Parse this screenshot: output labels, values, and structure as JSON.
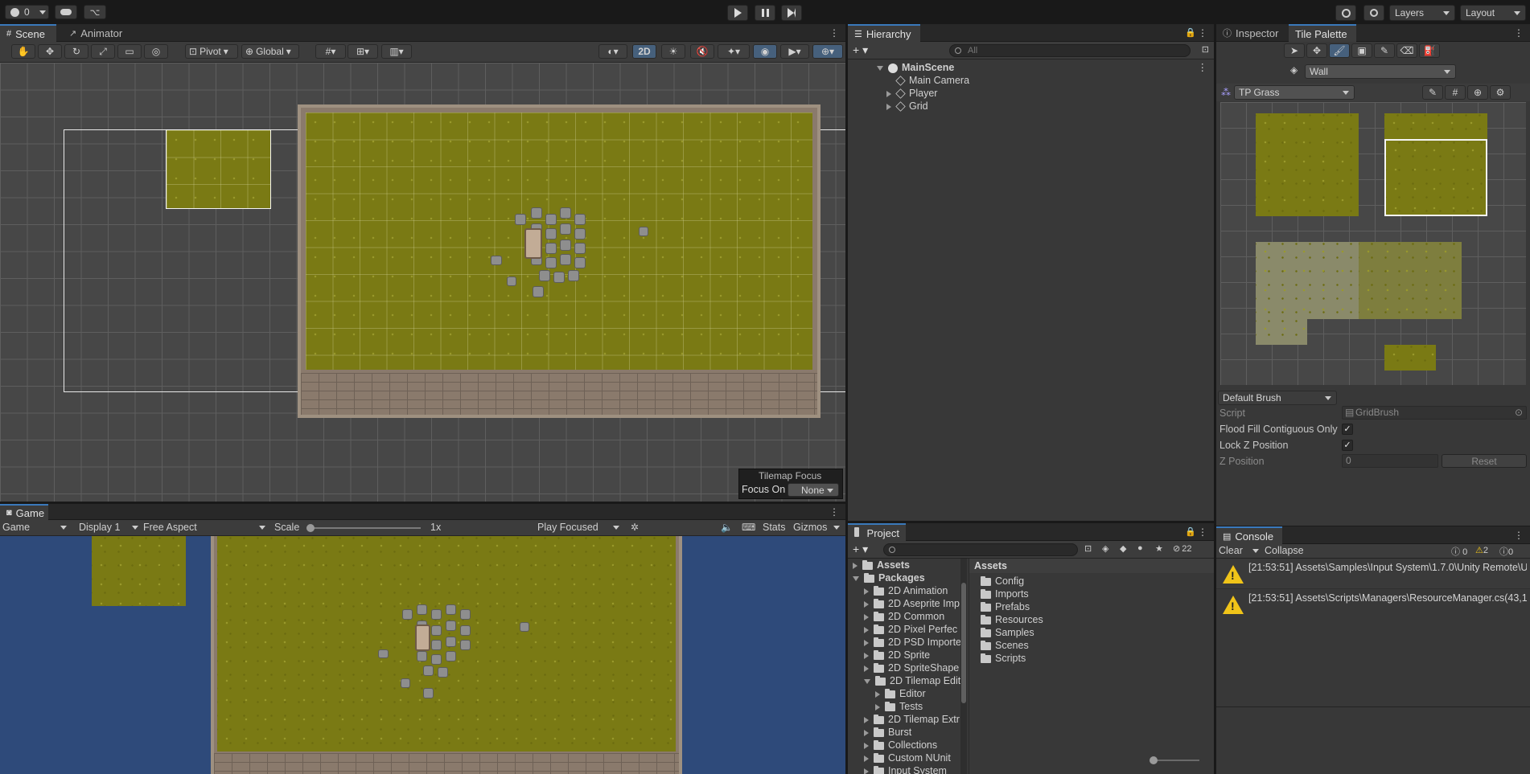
{
  "toolbar": {
    "account_label": "0",
    "layers_label": "Layers",
    "layout_label": "Layout"
  },
  "scene": {
    "tab_scene": "Scene",
    "tab_animator": "Animator",
    "pivot": "Pivot",
    "global": "Global",
    "mode_2d": "2D",
    "tilemap_focus_title": "Tilemap Focus",
    "focus_on_label": "Focus On",
    "focus_on_value": "None"
  },
  "game": {
    "tab": "Game",
    "display_dropdown": "Game",
    "display": "Display 1",
    "aspect": "Free Aspect",
    "scale_label": "Scale",
    "scale_value": "1x",
    "play_mode": "Play Focused",
    "stats": "Stats",
    "gizmos": "Gizmos"
  },
  "hierarchy": {
    "tab": "Hierarchy",
    "search_placeholder": "All",
    "scene": "MainScene",
    "items": [
      "Main Camera",
      "Player",
      "Grid"
    ]
  },
  "inspector": {
    "tab": "Inspector",
    "tab_palette": "Tile Palette",
    "active_tilemap": "Wall",
    "palette": "TP Grass",
    "brush": "Default Brush",
    "script_label": "Script",
    "script_value": "GridBrush",
    "flood_fill_label": "Flood Fill Contiguous Only",
    "lock_z_label": "Lock Z Position",
    "z_label": "Z Position",
    "z_value": "0",
    "reset": "Reset"
  },
  "project": {
    "tab": "Project",
    "count": "22",
    "tree": [
      {
        "label": "Assets",
        "indent": 0,
        "open": false,
        "bold": true
      },
      {
        "label": "Packages",
        "indent": 0,
        "open": true,
        "bold": true
      },
      {
        "label": "2D Animation",
        "indent": 1,
        "open": false
      },
      {
        "label": "2D Aseprite Imp",
        "indent": 1,
        "open": false
      },
      {
        "label": "2D Common",
        "indent": 1,
        "open": false
      },
      {
        "label": "2D Pixel Perfec",
        "indent": 1,
        "open": false
      },
      {
        "label": "2D PSD Importe",
        "indent": 1,
        "open": false
      },
      {
        "label": "2D Sprite",
        "indent": 1,
        "open": false
      },
      {
        "label": "2D SpriteShape",
        "indent": 1,
        "open": false
      },
      {
        "label": "2D Tilemap Edit",
        "indent": 1,
        "open": true
      },
      {
        "label": "Editor",
        "indent": 2,
        "open": false
      },
      {
        "label": "Tests",
        "indent": 2,
        "open": false
      },
      {
        "label": "2D Tilemap Extr",
        "indent": 1,
        "open": false
      },
      {
        "label": "Burst",
        "indent": 1,
        "open": false
      },
      {
        "label": "Collections",
        "indent": 1,
        "open": false
      },
      {
        "label": "Custom NUnit",
        "indent": 1,
        "open": false
      },
      {
        "label": "Input System",
        "indent": 1,
        "open": false
      }
    ],
    "assets_header": "Assets",
    "assets": [
      "Config",
      "Imports",
      "Prefabs",
      "Resources",
      "Samples",
      "Scenes",
      "Scripts"
    ]
  },
  "console": {
    "tab": "Console",
    "clear": "Clear",
    "collapse": "Collapse",
    "info_count": "0",
    "warn_count": "2",
    "error_count": "0",
    "messages": [
      "[21:53:51] Assets\\Samples\\Input System\\1.7.0\\Unity Remote\\U",
      "[21:53:51] Assets\\Scripts\\Managers\\ResourceManager.cs(43,1"
    ]
  }
}
